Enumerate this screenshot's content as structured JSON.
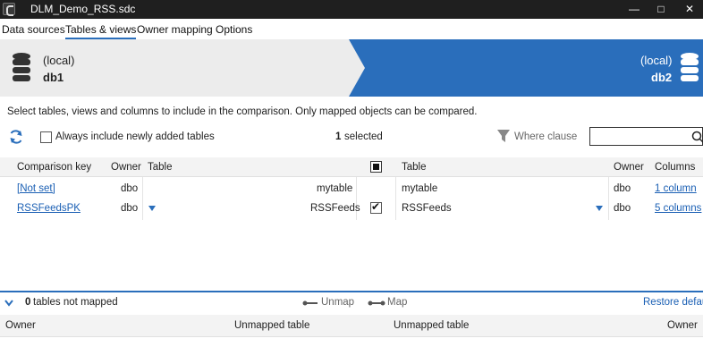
{
  "window": {
    "title": "DLM_Demo_RSS.sdc"
  },
  "tabs": [
    {
      "label": "Data sources"
    },
    {
      "label": "Tables & views"
    },
    {
      "label": "Owner mapping"
    },
    {
      "label": "Options"
    }
  ],
  "source_db": {
    "server": "(local)",
    "name": "db1"
  },
  "target_db": {
    "server": "(local)",
    "name": "db2"
  },
  "hint": "Select tables, views and columns to include in the comparison. Only mapped objects can be compared.",
  "toolbar": {
    "always_include_label": "Always include newly added tables",
    "selected_count": "1",
    "selected_label": "selected",
    "where_clause_label": "Where clause",
    "search_value": ""
  },
  "grid": {
    "headers": {
      "comparison_key": "Comparison key",
      "owner_left": "Owner",
      "table_left": "Table",
      "table_right": "Table",
      "owner_right": "Owner",
      "columns": "Columns"
    },
    "rows": [
      {
        "comparison_key": "[Not set]",
        "owner_left": "dbo",
        "table_left": "mytable",
        "included": false,
        "table_right": "mytable",
        "owner_right": "dbo",
        "columns": "1 column",
        "filtered": false
      },
      {
        "comparison_key": "RSSFeedsPK",
        "owner_left": "dbo",
        "table_left": "RSSFeeds",
        "included": true,
        "table_right": "RSSFeeds",
        "owner_right": "dbo",
        "columns": "5 columns",
        "filtered": true
      }
    ]
  },
  "unmapped": {
    "count": "0",
    "label": "tables not mapped",
    "unmap_label": "Unmap",
    "map_label": "Map",
    "restore_label": "Restore defau",
    "headers": {
      "owner_left": "Owner",
      "table_left": "Unmapped table",
      "table_right": "Unmapped table",
      "owner_right": "Owner"
    }
  },
  "colors": {
    "accent": "#2a6ebb",
    "titlebar": "#1f1f1f",
    "banner_left": "#ececec",
    "link": "#1a5fb4"
  }
}
